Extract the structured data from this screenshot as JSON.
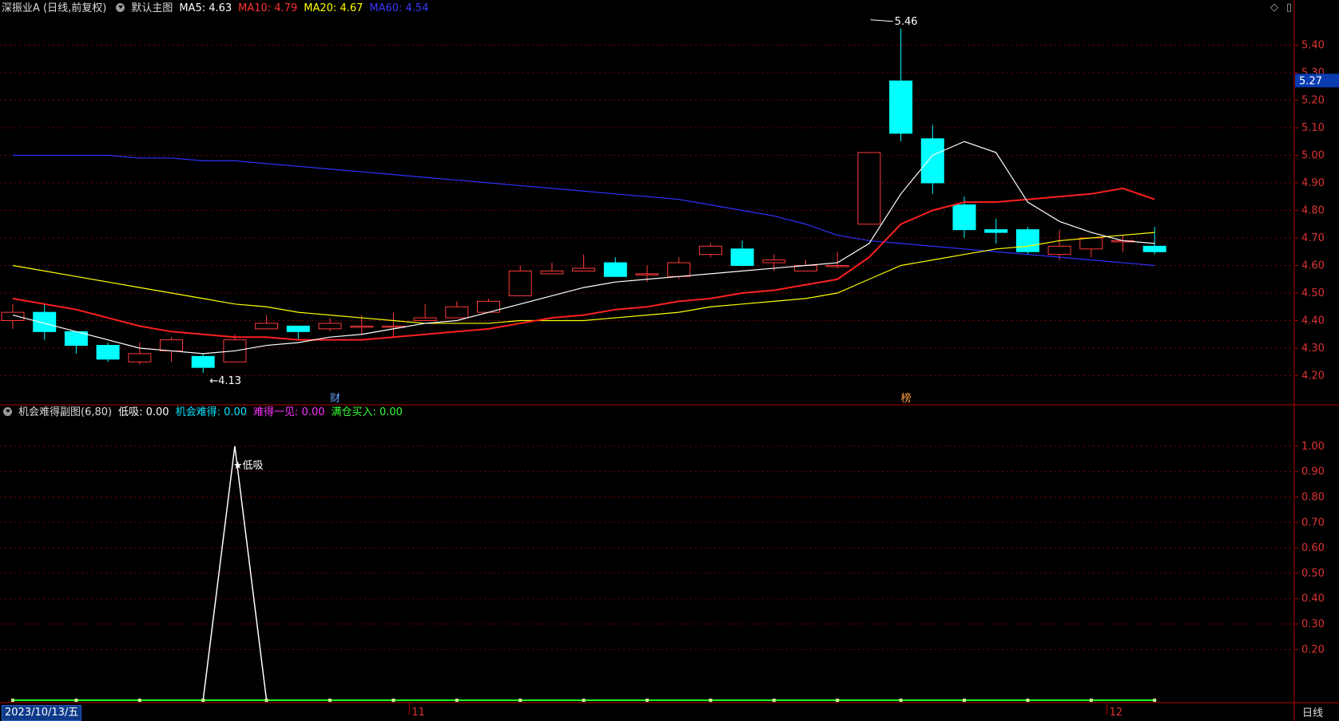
{
  "main_header": {
    "stock": "深振业A (日线,前复权)",
    "panel_name": "默认主图",
    "ma5": "MA5: 4.63",
    "ma10": "MA10: 4.79",
    "ma20": "MA20: 4.67",
    "ma60": "MA60: 4.54"
  },
  "sub_header": {
    "name": "机会难得副图(6,80)",
    "low_buy": "低吸: 0.00",
    "rare_chance": "机会难得: 0.00",
    "rare_seen": "难得一见: 0.00",
    "full_buy": "满仓买入: 0.00"
  },
  "bottom_bar": {
    "date": "2023/10/13/五",
    "period": "日线"
  },
  "colors": {
    "up": "#ff3b3b",
    "down": "#00ffff",
    "ma5": "#ffffff",
    "ma10": "#ff2020",
    "ma20": "#ffff00",
    "ma60": "#3030ff",
    "grid": "#7a0000",
    "axis": "#b00000"
  },
  "chart_data": [
    {
      "type": "candlestick",
      "ylim": [
        4.1,
        5.5
      ],
      "yticks": [
        "5.40",
        "5.30",
        "5.20",
        "5.10",
        "5.00",
        "4.90",
        "4.80",
        "4.70",
        "4.60",
        "4.50",
        "4.40",
        "4.30",
        "4.20"
      ],
      "current_price": "5.27",
      "annotations": {
        "max": "5.46",
        "min": "4.13",
        "fin_marker": "财",
        "rank_marker": "榜"
      },
      "x_labels": [
        {
          "i": 13,
          "label": "11"
        },
        {
          "i": 35,
          "label": "12"
        }
      ],
      "candles": [
        [
          4.4,
          4.43,
          4.46,
          4.37
        ],
        [
          4.43,
          4.36,
          4.46,
          4.33
        ],
        [
          4.36,
          4.31,
          4.36,
          4.28
        ],
        [
          4.31,
          4.26,
          4.32,
          4.25
        ],
        [
          4.25,
          4.28,
          4.32,
          4.24
        ],
        [
          4.29,
          4.33,
          4.34,
          4.25
        ],
        [
          4.27,
          4.23,
          4.28,
          4.21
        ],
        [
          4.25,
          4.33,
          4.35,
          4.25
        ],
        [
          4.37,
          4.39,
          4.42,
          4.38
        ],
        [
          4.38,
          4.36,
          4.38,
          4.33
        ],
        [
          4.37,
          4.39,
          4.41,
          4.36
        ],
        [
          4.38,
          4.38,
          4.42,
          4.35
        ],
        [
          4.38,
          4.38,
          4.43,
          4.34
        ],
        [
          4.4,
          4.41,
          4.46,
          4.4
        ],
        [
          4.41,
          4.45,
          4.47,
          4.41
        ],
        [
          4.43,
          4.47,
          4.48,
          4.43
        ],
        [
          4.49,
          4.58,
          4.6,
          4.49
        ],
        [
          4.57,
          4.58,
          4.61,
          4.57
        ],
        [
          4.58,
          4.59,
          4.64,
          4.58
        ],
        [
          4.61,
          4.56,
          4.63,
          4.56
        ],
        [
          4.57,
          4.57,
          4.6,
          4.54
        ],
        [
          4.56,
          4.61,
          4.63,
          4.55
        ],
        [
          4.64,
          4.67,
          4.68,
          4.63
        ],
        [
          4.66,
          4.6,
          4.69,
          4.6
        ],
        [
          4.61,
          4.62,
          4.64,
          4.58
        ],
        [
          4.58,
          4.6,
          4.62,
          4.58
        ],
        [
          4.6,
          4.6,
          4.65,
          4.59
        ],
        [
          4.75,
          5.01,
          5.01,
          4.75
        ],
        [
          5.27,
          5.08,
          5.46,
          5.05
        ],
        [
          5.06,
          4.9,
          5.11,
          4.86
        ],
        [
          4.82,
          4.73,
          4.85,
          4.7
        ],
        [
          4.73,
          4.72,
          4.77,
          4.68
        ],
        [
          4.73,
          4.65,
          4.74,
          4.64
        ],
        [
          4.64,
          4.67,
          4.73,
          4.62
        ],
        [
          4.66,
          4.7,
          4.7,
          4.63
        ],
        [
          4.69,
          4.69,
          4.71,
          4.65
        ],
        [
          4.67,
          4.65,
          4.74,
          4.64
        ]
      ],
      "ma5": [
        4.42,
        4.39,
        4.36,
        4.33,
        4.3,
        4.29,
        4.28,
        4.29,
        4.31,
        4.32,
        4.34,
        4.35,
        4.37,
        4.39,
        4.4,
        4.43,
        4.46,
        4.49,
        4.52,
        4.54,
        4.55,
        4.56,
        4.57,
        4.58,
        4.59,
        4.6,
        4.61,
        4.68,
        4.86,
        5.0,
        5.05,
        5.01,
        4.83,
        4.76,
        4.72,
        4.69,
        4.68
      ],
      "ma10": [
        4.48,
        4.46,
        4.44,
        4.41,
        4.38,
        4.36,
        4.35,
        4.34,
        4.34,
        4.33,
        4.33,
        4.33,
        4.34,
        4.35,
        4.36,
        4.37,
        4.39,
        4.41,
        4.42,
        4.44,
        4.45,
        4.47,
        4.48,
        4.5,
        4.51,
        4.53,
        4.55,
        4.63,
        4.75,
        4.8,
        4.83,
        4.83,
        4.84,
        4.85,
        4.86,
        4.88,
        4.84
      ],
      "ma20": [
        4.6,
        4.58,
        4.56,
        4.54,
        4.52,
        4.5,
        4.48,
        4.46,
        4.45,
        4.43,
        4.42,
        4.41,
        4.4,
        4.39,
        4.39,
        4.39,
        4.4,
        4.4,
        4.4,
        4.41,
        4.42,
        4.43,
        4.45,
        4.46,
        4.47,
        4.48,
        4.5,
        4.55,
        4.6,
        4.62,
        4.64,
        4.66,
        4.67,
        4.69,
        4.7,
        4.71,
        4.72
      ],
      "ma60": [
        5.0,
        5.0,
        5.0,
        5.0,
        4.99,
        4.99,
        4.98,
        4.98,
        4.97,
        4.96,
        4.95,
        4.94,
        4.93,
        4.92,
        4.91,
        4.9,
        4.89,
        4.88,
        4.87,
        4.86,
        4.85,
        4.84,
        4.82,
        4.8,
        4.78,
        4.75,
        4.71,
        4.69,
        4.68,
        4.67,
        4.66,
        4.65,
        4.64,
        4.63,
        4.62,
        4.61,
        4.6
      ]
    },
    {
      "type": "line",
      "ylim": [
        0,
        1.1
      ],
      "yticks": [
        "1.00",
        "0.90",
        "0.80",
        "0.70",
        "0.60",
        "0.50",
        "0.40",
        "0.30",
        "0.20"
      ],
      "signal_label": "★低吸",
      "low_buy": [
        0,
        0,
        0,
        0,
        0,
        0,
        0,
        1,
        0,
        0,
        0,
        0,
        0,
        0,
        0,
        0,
        0,
        0,
        0,
        0,
        0,
        0,
        0,
        0,
        0,
        0,
        0,
        0,
        0,
        0,
        0,
        0,
        0,
        0,
        0,
        0,
        0
      ],
      "full_buy_markers": [
        0,
        2,
        4,
        6,
        8,
        10,
        12,
        14,
        16,
        18,
        20,
        22,
        24,
        26,
        28,
        30,
        32,
        34,
        36
      ]
    }
  ]
}
